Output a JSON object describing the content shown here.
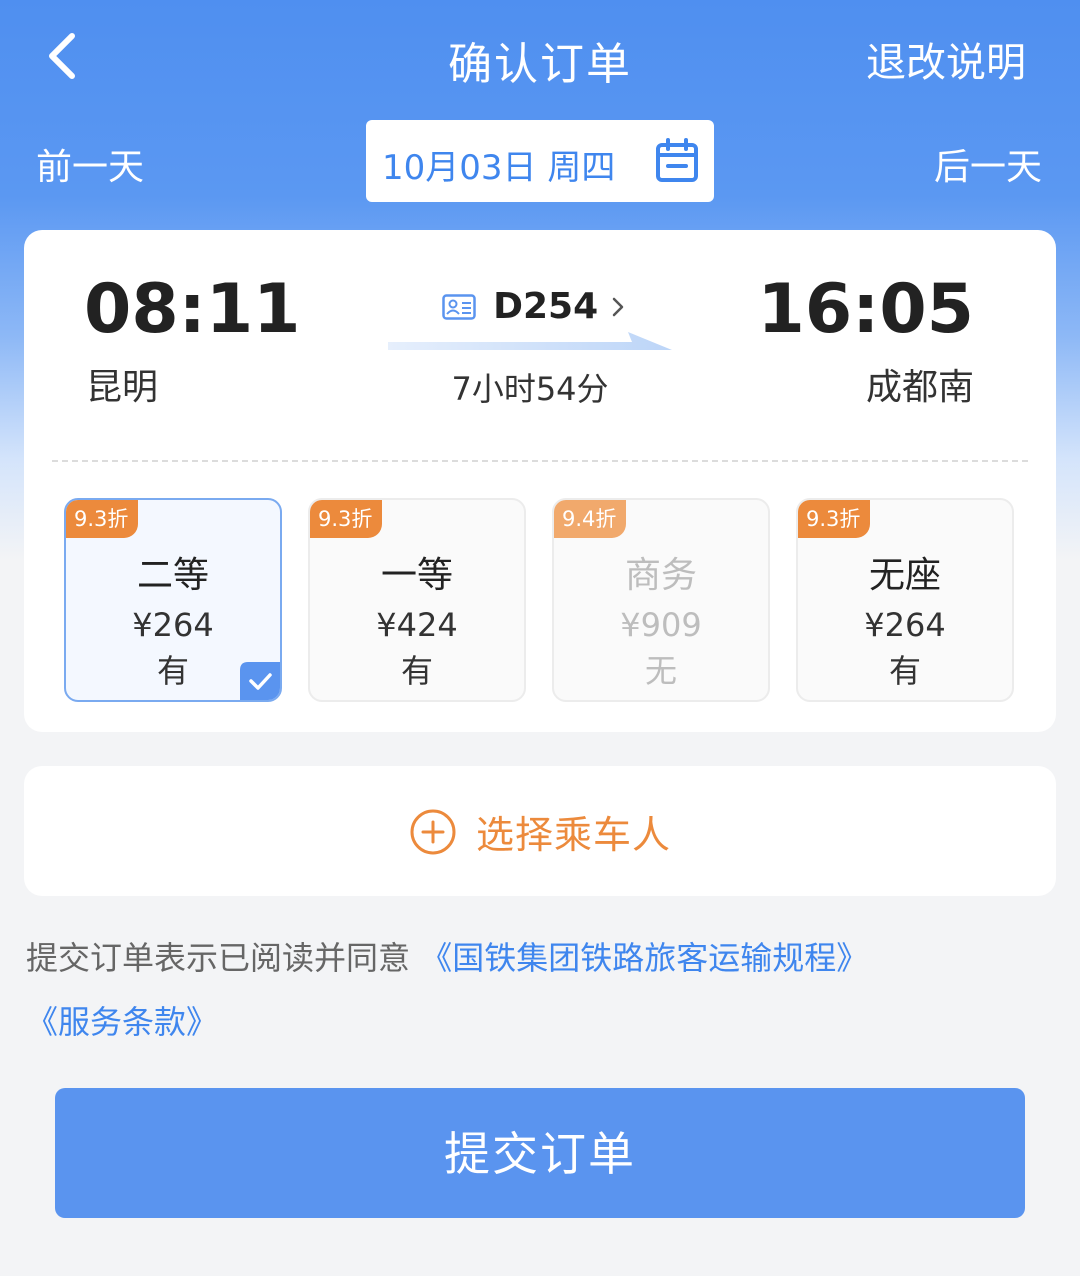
{
  "header": {
    "title": "确认订单",
    "refund_link": "退改说明",
    "back_icon": "chevron-left-icon"
  },
  "date_nav": {
    "prev": "前一天",
    "date": "10月03日 周四",
    "next": "后一天",
    "calendar_icon": "calendar-icon"
  },
  "trip": {
    "departure": {
      "time": "08:11",
      "station": "昆明"
    },
    "arrival": {
      "time": "16:05",
      "station": "成都南"
    },
    "train_number": "D254",
    "duration": "7小时54分"
  },
  "seats": [
    {
      "discount": "9.3折",
      "name": "二等",
      "price": "¥264",
      "availability": "有",
      "selected": true,
      "enabled": true
    },
    {
      "discount": "9.3折",
      "name": "一等",
      "price": "¥424",
      "availability": "有",
      "selected": false,
      "enabled": true
    },
    {
      "discount": "9.4折",
      "name": "商务",
      "price": "¥909",
      "availability": "无",
      "selected": false,
      "enabled": false
    },
    {
      "discount": "9.3折",
      "name": "无座",
      "price": "¥264",
      "availability": "有",
      "selected": false,
      "enabled": true
    }
  ],
  "passenger": {
    "label": "选择乘车人",
    "icon": "plus-circle-icon"
  },
  "agreement": {
    "prefix": "提交订单表示已阅读并同意",
    "link1": "《国铁集团铁路旅客运输规程》",
    "link2": "《服务条款》"
  },
  "submit_label": "提交订单",
  "colors": {
    "primary": "#5a94ef",
    "accent_orange": "#ec8a3c",
    "link_blue": "#3f86ee"
  }
}
